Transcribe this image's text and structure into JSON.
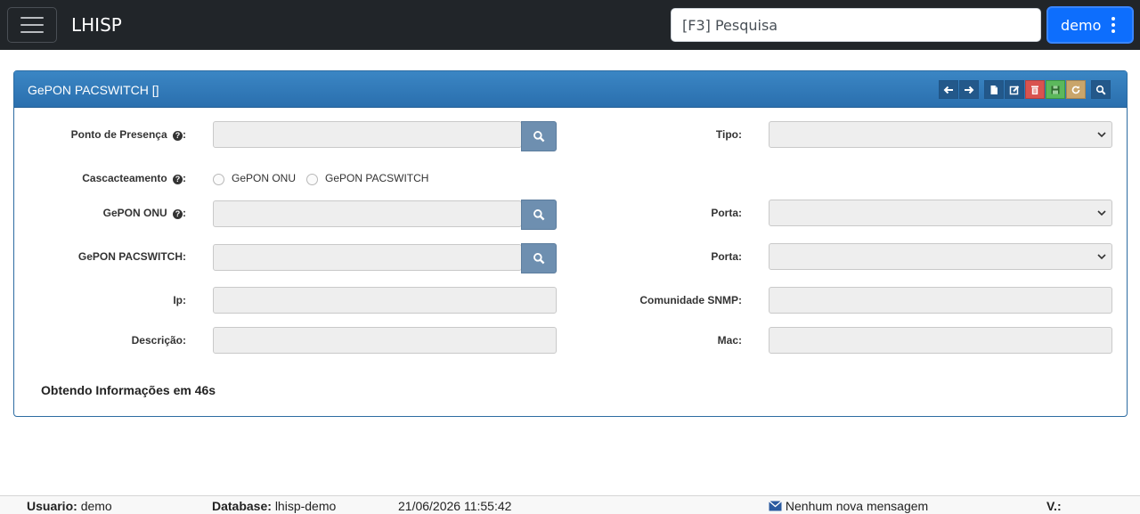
{
  "app": {
    "brand": "LHISP"
  },
  "search": {
    "placeholder": "[F3] Pesquisa"
  },
  "user": {
    "name": "demo"
  },
  "panel": {
    "title": "GePON PACSWITCH []",
    "fields": {
      "pop_label": "Ponto de Presença",
      "tipo_label": "Tipo:",
      "cascade_label": "Cascacteamento",
      "cascade_opt1": "GePON ONU",
      "cascade_opt2": "GePON PACSWITCH",
      "onu_label": "GePON ONU",
      "porta1_label": "Porta:",
      "pacswitch_label": "GePON PACSWITCH:",
      "porta2_label": "Porta:",
      "ip_label": "Ip:",
      "snmp_label": "Comunidade SNMP:",
      "desc_label": "Descrição:",
      "mac_label": "Mac:",
      "colon": ":"
    },
    "status": "Obtendo Informações em 46s"
  },
  "footer": {
    "usuario_key": "Usuario:",
    "usuario_val": "demo",
    "database_key": "Database:",
    "database_val": "lhisp-demo",
    "datetime": "21/06/2026 11:55:42",
    "messages": "Nenhum nova mensagem",
    "version_key": "V.:"
  },
  "colors": {
    "topbar": "#212529",
    "panel_header": "#3071ae",
    "user_button": "#0d6efd"
  }
}
